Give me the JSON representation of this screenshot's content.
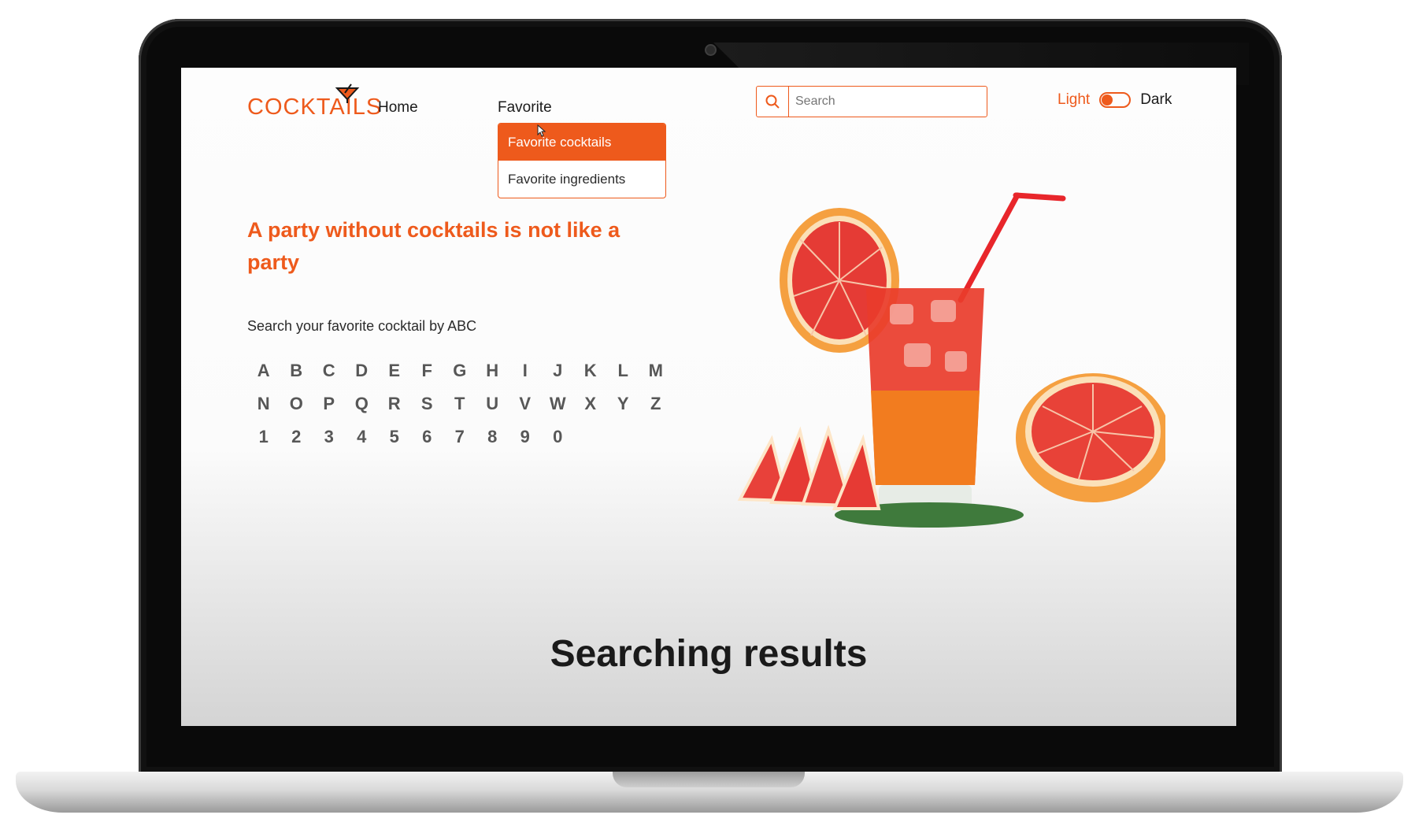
{
  "brand": {
    "logo_text": "COCKTAILS",
    "accent": "#ee5a1c"
  },
  "nav": {
    "home": "Home",
    "favorite": "Favorite",
    "dropdown": [
      "Favorite cocktails",
      "Favorite ingredients"
    ]
  },
  "search": {
    "placeholder": "Search",
    "icon": "search-icon"
  },
  "theme": {
    "light": "Light",
    "dark": "Dark",
    "state": "light"
  },
  "hero": {
    "headline": "A party without cocktails is not like a party",
    "subtext": "Search your favorite cocktail by ABC"
  },
  "alphabet": [
    "A",
    "B",
    "C",
    "D",
    "E",
    "F",
    "G",
    "H",
    "I",
    "J",
    "K",
    "L",
    "M",
    "N",
    "O",
    "P",
    "Q",
    "R",
    "S",
    "T",
    "U",
    "V",
    "W",
    "X",
    "Y",
    "Z",
    "1",
    "2",
    "3",
    "4",
    "5",
    "6",
    "7",
    "8",
    "9",
    "0"
  ],
  "results": {
    "title": "Searching results"
  }
}
